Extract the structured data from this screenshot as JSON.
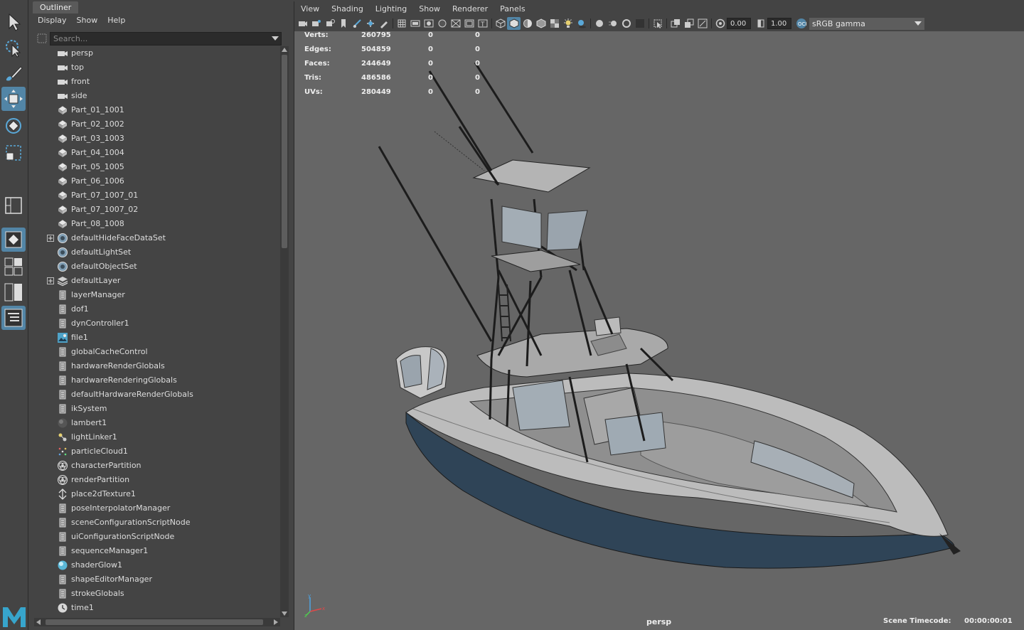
{
  "outliner": {
    "tab": "Outliner",
    "menu": [
      "Display",
      "Show",
      "Help"
    ],
    "search_placeholder": "Search...",
    "items": [
      {
        "label": "persp",
        "icon": "camera-icon",
        "expandable": false
      },
      {
        "label": "top",
        "icon": "camera-icon",
        "expandable": false
      },
      {
        "label": "front",
        "icon": "camera-icon",
        "expandable": false
      },
      {
        "label": "side",
        "icon": "camera-icon",
        "expandable": false
      },
      {
        "label": "Part_01_1001",
        "icon": "mesh-icon",
        "expandable": false
      },
      {
        "label": "Part_02_1002",
        "icon": "mesh-icon",
        "expandable": false
      },
      {
        "label": "Part_03_1003",
        "icon": "mesh-icon",
        "expandable": false
      },
      {
        "label": "Part_04_1004",
        "icon": "mesh-icon",
        "expandable": false
      },
      {
        "label": "Part_05_1005",
        "icon": "mesh-icon",
        "expandable": false
      },
      {
        "label": "Part_06_1006",
        "icon": "mesh-icon",
        "expandable": false
      },
      {
        "label": "Part_07_1007_01",
        "icon": "mesh-icon",
        "expandable": false
      },
      {
        "label": "Part_07_1007_02",
        "icon": "mesh-icon",
        "expandable": false
      },
      {
        "label": "Part_08_1008",
        "icon": "mesh-icon",
        "expandable": false
      },
      {
        "label": "defaultHideFaceDataSet",
        "icon": "set-icon",
        "expandable": true
      },
      {
        "label": "defaultLightSet",
        "icon": "set-icon",
        "expandable": false
      },
      {
        "label": "defaultObjectSet",
        "icon": "set-icon",
        "expandable": false
      },
      {
        "label": "defaultLayer",
        "icon": "layer-icon",
        "expandable": true
      },
      {
        "label": "layerManager",
        "icon": "node-icon",
        "expandable": false
      },
      {
        "label": "dof1",
        "icon": "node-icon",
        "expandable": false
      },
      {
        "label": "dynController1",
        "icon": "node-icon",
        "expandable": false
      },
      {
        "label": "file1",
        "icon": "file-texture-icon",
        "expandable": false
      },
      {
        "label": "globalCacheControl",
        "icon": "node-icon",
        "expandable": false
      },
      {
        "label": "hardwareRenderGlobals",
        "icon": "node-icon",
        "expandable": false
      },
      {
        "label": "hardwareRenderingGlobals",
        "icon": "node-icon",
        "expandable": false
      },
      {
        "label": "defaultHardwareRenderGlobals",
        "icon": "node-icon",
        "expandable": false
      },
      {
        "label": "ikSystem",
        "icon": "node-icon",
        "expandable": false
      },
      {
        "label": "lambert1",
        "icon": "material-sphere-icon",
        "expandable": false
      },
      {
        "label": "lightLinker1",
        "icon": "light-linker-icon",
        "expandable": false
      },
      {
        "label": "particleCloud1",
        "icon": "particle-icon",
        "expandable": false
      },
      {
        "label": "characterPartition",
        "icon": "partition-icon",
        "expandable": false
      },
      {
        "label": "renderPartition",
        "icon": "partition-icon",
        "expandable": false
      },
      {
        "label": "place2dTexture1",
        "icon": "place2d-icon",
        "expandable": false
      },
      {
        "label": "poseInterpolatorManager",
        "icon": "node-icon",
        "expandable": false
      },
      {
        "label": "sceneConfigurationScriptNode",
        "icon": "node-icon",
        "expandable": false
      },
      {
        "label": "uiConfigurationScriptNode",
        "icon": "node-icon",
        "expandable": false
      },
      {
        "label": "sequenceManager1",
        "icon": "node-icon",
        "expandable": false
      },
      {
        "label": "shaderGlow1",
        "icon": "glow-sphere-icon",
        "expandable": false
      },
      {
        "label": "shapeEditorManager",
        "icon": "node-icon",
        "expandable": false
      },
      {
        "label": "strokeGlobals",
        "icon": "node-icon",
        "expandable": false
      },
      {
        "label": "time1",
        "icon": "clock-icon",
        "expandable": false
      }
    ]
  },
  "viewport": {
    "menu": [
      "View",
      "Shading",
      "Lighting",
      "Show",
      "Renderer",
      "Panels"
    ],
    "exposure": "0.00",
    "gamma": "1.00",
    "color_space": "sRGB gamma",
    "hud": [
      {
        "label": "Verts:",
        "total": "260795",
        "c1": "0",
        "c2": "0"
      },
      {
        "label": "Edges:",
        "total": "504859",
        "c1": "0",
        "c2": "0"
      },
      {
        "label": "Faces:",
        "total": "244649",
        "c1": "0",
        "c2": "0"
      },
      {
        "label": "Tris:",
        "total": "486586",
        "c1": "0",
        "c2": "0"
      },
      {
        "label": "UVs:",
        "total": "280449",
        "c1": "0",
        "c2": "0"
      }
    ],
    "camera": "persp",
    "timecode_label": "Scene Timecode:",
    "timecode": "00:00:00:01"
  },
  "colors": {
    "accent": "#5285a6",
    "panel_bg": "#444444",
    "viewport_bg": "#666666",
    "hull": "#2f4457",
    "deck": "#b8b8b8"
  }
}
